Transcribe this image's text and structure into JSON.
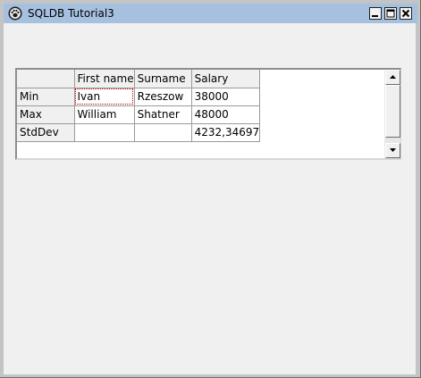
{
  "window": {
    "title": "SQLDB Tutorial3",
    "icon": "paw-icon"
  },
  "grid": {
    "columns": [
      "",
      "First name",
      "Surname",
      "Salary"
    ],
    "rows": [
      {
        "header": "Min",
        "cells": [
          "Ivan",
          "Rzeszow",
          "38000"
        ]
      },
      {
        "header": "Max",
        "cells": [
          "William",
          "Shatner",
          "48000"
        ]
      },
      {
        "header": "StdDev",
        "cells": [
          "",
          "",
          "4232,34697"
        ]
      }
    ],
    "focused_cell": {
      "row": 0,
      "col": 0
    }
  },
  "colors": {
    "titlebar": "#a6c1e0",
    "client": "#f0f0f0",
    "focus": "#c00000"
  }
}
